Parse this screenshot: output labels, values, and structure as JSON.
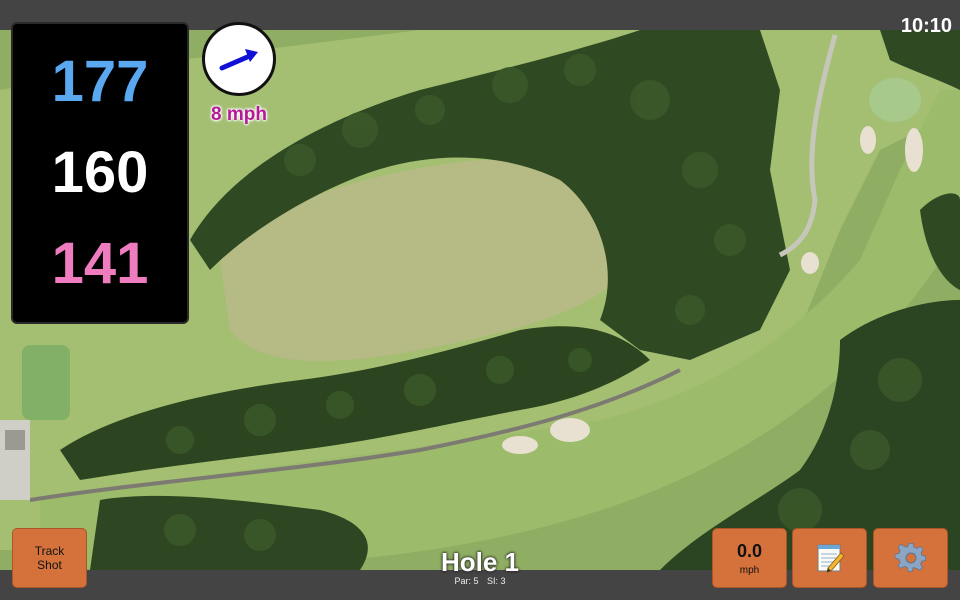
{
  "status": {
    "clock": "10:10"
  },
  "distances": {
    "back": "177",
    "center": "160",
    "front": "141"
  },
  "wind": {
    "speed": "8 mph",
    "direction_degrees": 70
  },
  "hole": {
    "title": "Hole 1",
    "par_text": "Par: 5",
    "si_text": "SI: 3"
  },
  "controls": {
    "track_shot_line1": "Track",
    "track_shot_line2": "Shot",
    "speed_value": "0.0",
    "speed_unit": "mph",
    "notes_icon": "notepad-icon",
    "settings_icon": "gear-icon"
  },
  "colors": {
    "back_distance": "#5aa8f0",
    "center_distance": "#ffffff",
    "front_distance": "#f07cc0",
    "button_orange": "#d5723c",
    "wind_text": "#b5199a"
  }
}
